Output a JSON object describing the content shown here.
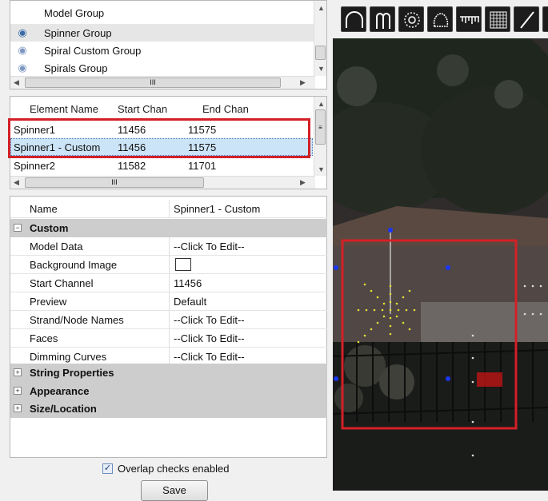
{
  "groups": {
    "items": [
      {
        "label": "Model Group",
        "icon": "none"
      },
      {
        "label": "Spinner Group",
        "icon": "eye-icon"
      },
      {
        "label": "Spiral Custom Group",
        "icon": "eye-icon"
      },
      {
        "label": "Spirals Group",
        "icon": "eye-icon"
      }
    ],
    "hscroll_mark": "III"
  },
  "elements": {
    "headers": [
      "Element Name",
      "Start Chan",
      "End Chan"
    ],
    "rows": [
      {
        "name": "Spinner1",
        "start": "11456",
        "end": "11575"
      },
      {
        "name": "Spinner1 - Custom",
        "start": "11456",
        "end": "11575",
        "selected": true
      },
      {
        "name": "Spinner2",
        "start": "11582",
        "end": "11701"
      }
    ],
    "hscroll_mark": "III"
  },
  "properties": {
    "name_label": "Name",
    "name_value": "Spinner1 - Custom",
    "custom_label": "Custom",
    "rows": [
      {
        "key": "Model Data",
        "value": "--Click To Edit--"
      },
      {
        "key": "Background Image",
        "value": ""
      },
      {
        "key": "Start Channel",
        "value": "11456"
      },
      {
        "key": "Preview",
        "value": "Default"
      },
      {
        "key": "Strand/Node Names",
        "value": "--Click To Edit--"
      },
      {
        "key": "Faces",
        "value": "--Click To Edit--"
      },
      {
        "key": "Dimming Curves",
        "value": "--Click To Edit--"
      }
    ],
    "categories": [
      "String Properties",
      "Appearance",
      "Size/Location"
    ]
  },
  "overlap_label": "Overlap checks enabled",
  "overlap_checked": true,
  "save_label": "Save",
  "colors": {
    "highlight": "#d32027",
    "selection": "#cce4f7",
    "category": "#cdcdcd"
  },
  "toolbar_icons": [
    "arch-icon",
    "candy-cane-icon",
    "circle-icon",
    "star-icon",
    "icicles-icon",
    "matrix-icon",
    "line-icon",
    "more-icon"
  ]
}
